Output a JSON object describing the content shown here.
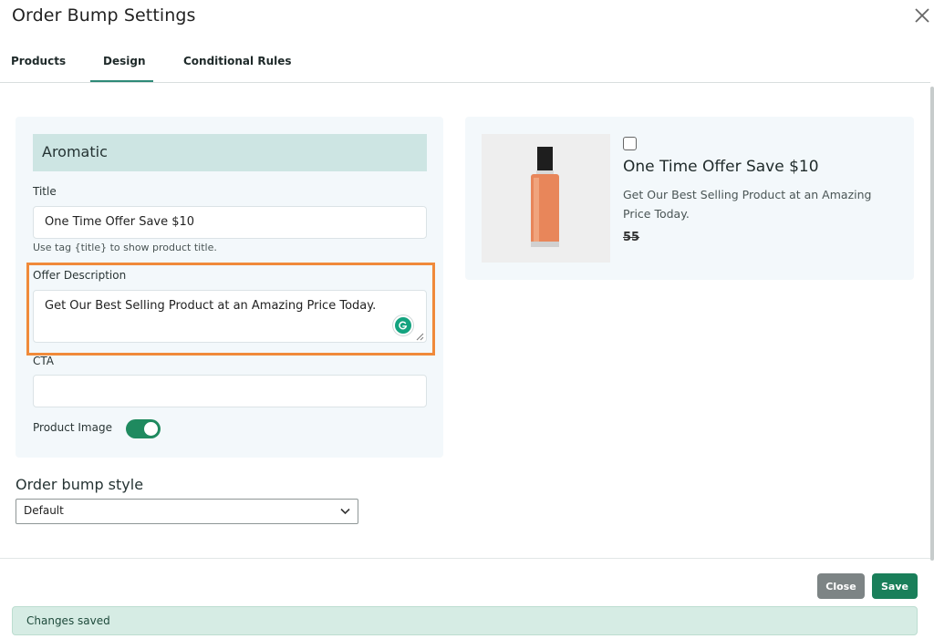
{
  "modal": {
    "title": "Order Bump Settings"
  },
  "tabs": [
    {
      "label": "Products"
    },
    {
      "label": "Design",
      "active": true
    },
    {
      "label": "Conditional Rules"
    }
  ],
  "form": {
    "section_title": "Aromatic",
    "title_label": "Title",
    "title_value": "One Time Offer Save $10",
    "title_hint": "Use tag {title} to show product title.",
    "offer_label": "Offer Description",
    "offer_value": "Get Our Best Selling Product at an Amazing Price Today.",
    "cta_label": "CTA",
    "cta_value": "",
    "product_image_label": "Product Image",
    "product_image_enabled": true
  },
  "style": {
    "label": "Order bump style",
    "selected": "Default"
  },
  "preview": {
    "title": "One Time Offer Save $10",
    "description": "Get Our Best Selling Product at an Amazing Price Today.",
    "price": "55"
  },
  "footer": {
    "close_label": "Close",
    "save_label": "Save"
  },
  "toast": {
    "message": "Changes saved"
  },
  "colors": {
    "accent": "#2e8a77",
    "toggle_on": "#1f8a5f",
    "highlight": "#f08a3a",
    "save_button": "#1a7f5a",
    "close_button": "#7d8485",
    "section_header": "#cde5e3",
    "panel_bg": "#f3f8fb",
    "toast_bg": "#d6ece4"
  },
  "icons": {
    "close": "close-icon",
    "chevron": "chevron-down-icon",
    "grammarly": "grammarly-icon",
    "resize": "resize-grip-icon"
  }
}
